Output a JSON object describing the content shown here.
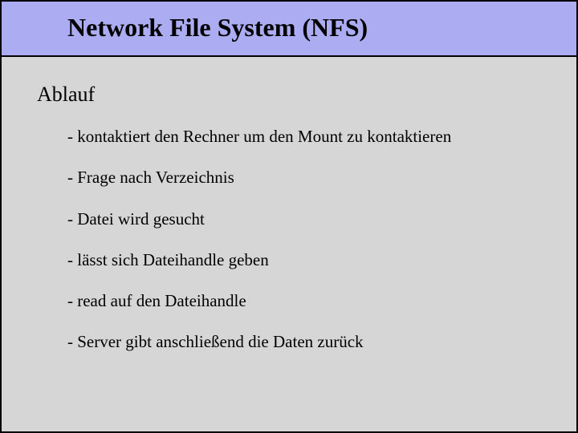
{
  "title": "Network File System (NFS)",
  "section_heading": "Ablauf",
  "bullets": [
    "- kontaktiert den Rechner um den Mount zu kontaktieren",
    "- Frage nach Verzeichnis",
    "- Datei wird gesucht",
    "- lässt sich Dateihandle geben",
    "- read auf den Dateihandle",
    "- Server gibt anschließend die Daten zurück"
  ]
}
